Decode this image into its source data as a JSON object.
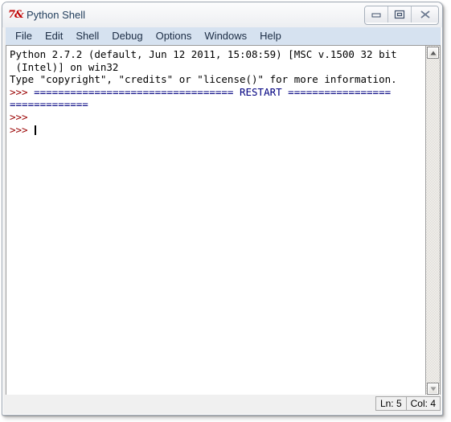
{
  "window": {
    "title": "Python Shell",
    "icon": "python-idle-icon",
    "icon_glyph": "7&",
    "controls": [
      {
        "name": "minimize-button",
        "label": "Minimize"
      },
      {
        "name": "maximize-button",
        "label": "Maximize"
      },
      {
        "name": "close-button",
        "label": "Close"
      }
    ]
  },
  "menubar": {
    "items": [
      {
        "label": "File"
      },
      {
        "label": "Edit"
      },
      {
        "label": "Shell"
      },
      {
        "label": "Debug"
      },
      {
        "label": "Options"
      },
      {
        "label": "Windows"
      },
      {
        "label": "Help"
      }
    ]
  },
  "console": {
    "lines": [
      {
        "segments": [
          {
            "text": "Python 2.7.2 (default, Jun 12 2011, 15:08:59) [MSC v.1500 32 bit",
            "style": "plain"
          }
        ]
      },
      {
        "segments": [
          {
            "text": " (Intel)] on win32",
            "style": "plain"
          }
        ]
      },
      {
        "segments": [
          {
            "text": "Type \"copyright\", \"credits\" or \"license()\" for more information.",
            "style": "plain"
          }
        ]
      },
      {
        "segments": [
          {
            "text": ">>> ",
            "style": "prompt"
          },
          {
            "text": "================================= RESTART =================",
            "style": "restart"
          }
        ]
      },
      {
        "segments": [
          {
            "text": "=============",
            "style": "restart"
          }
        ]
      },
      {
        "segments": [
          {
            "text": ">>> ",
            "style": "prompt"
          }
        ]
      },
      {
        "segments": [
          {
            "text": ">>> ",
            "style": "prompt"
          },
          {
            "text": "",
            "style": "caret"
          }
        ]
      }
    ]
  },
  "scrollbar": {
    "up_arrow": "scroll-up-arrow-icon",
    "down_arrow": "scroll-down-arrow-icon"
  },
  "statusbar": {
    "line_label": "Ln: 5",
    "col_label": "Col: 4"
  },
  "colors": {
    "prompt_red": "#990000",
    "restart_blue": "#000080",
    "menubar_bg": "#d6e2f0",
    "title_text": "#24405e",
    "icon_red": "#c00000"
  }
}
